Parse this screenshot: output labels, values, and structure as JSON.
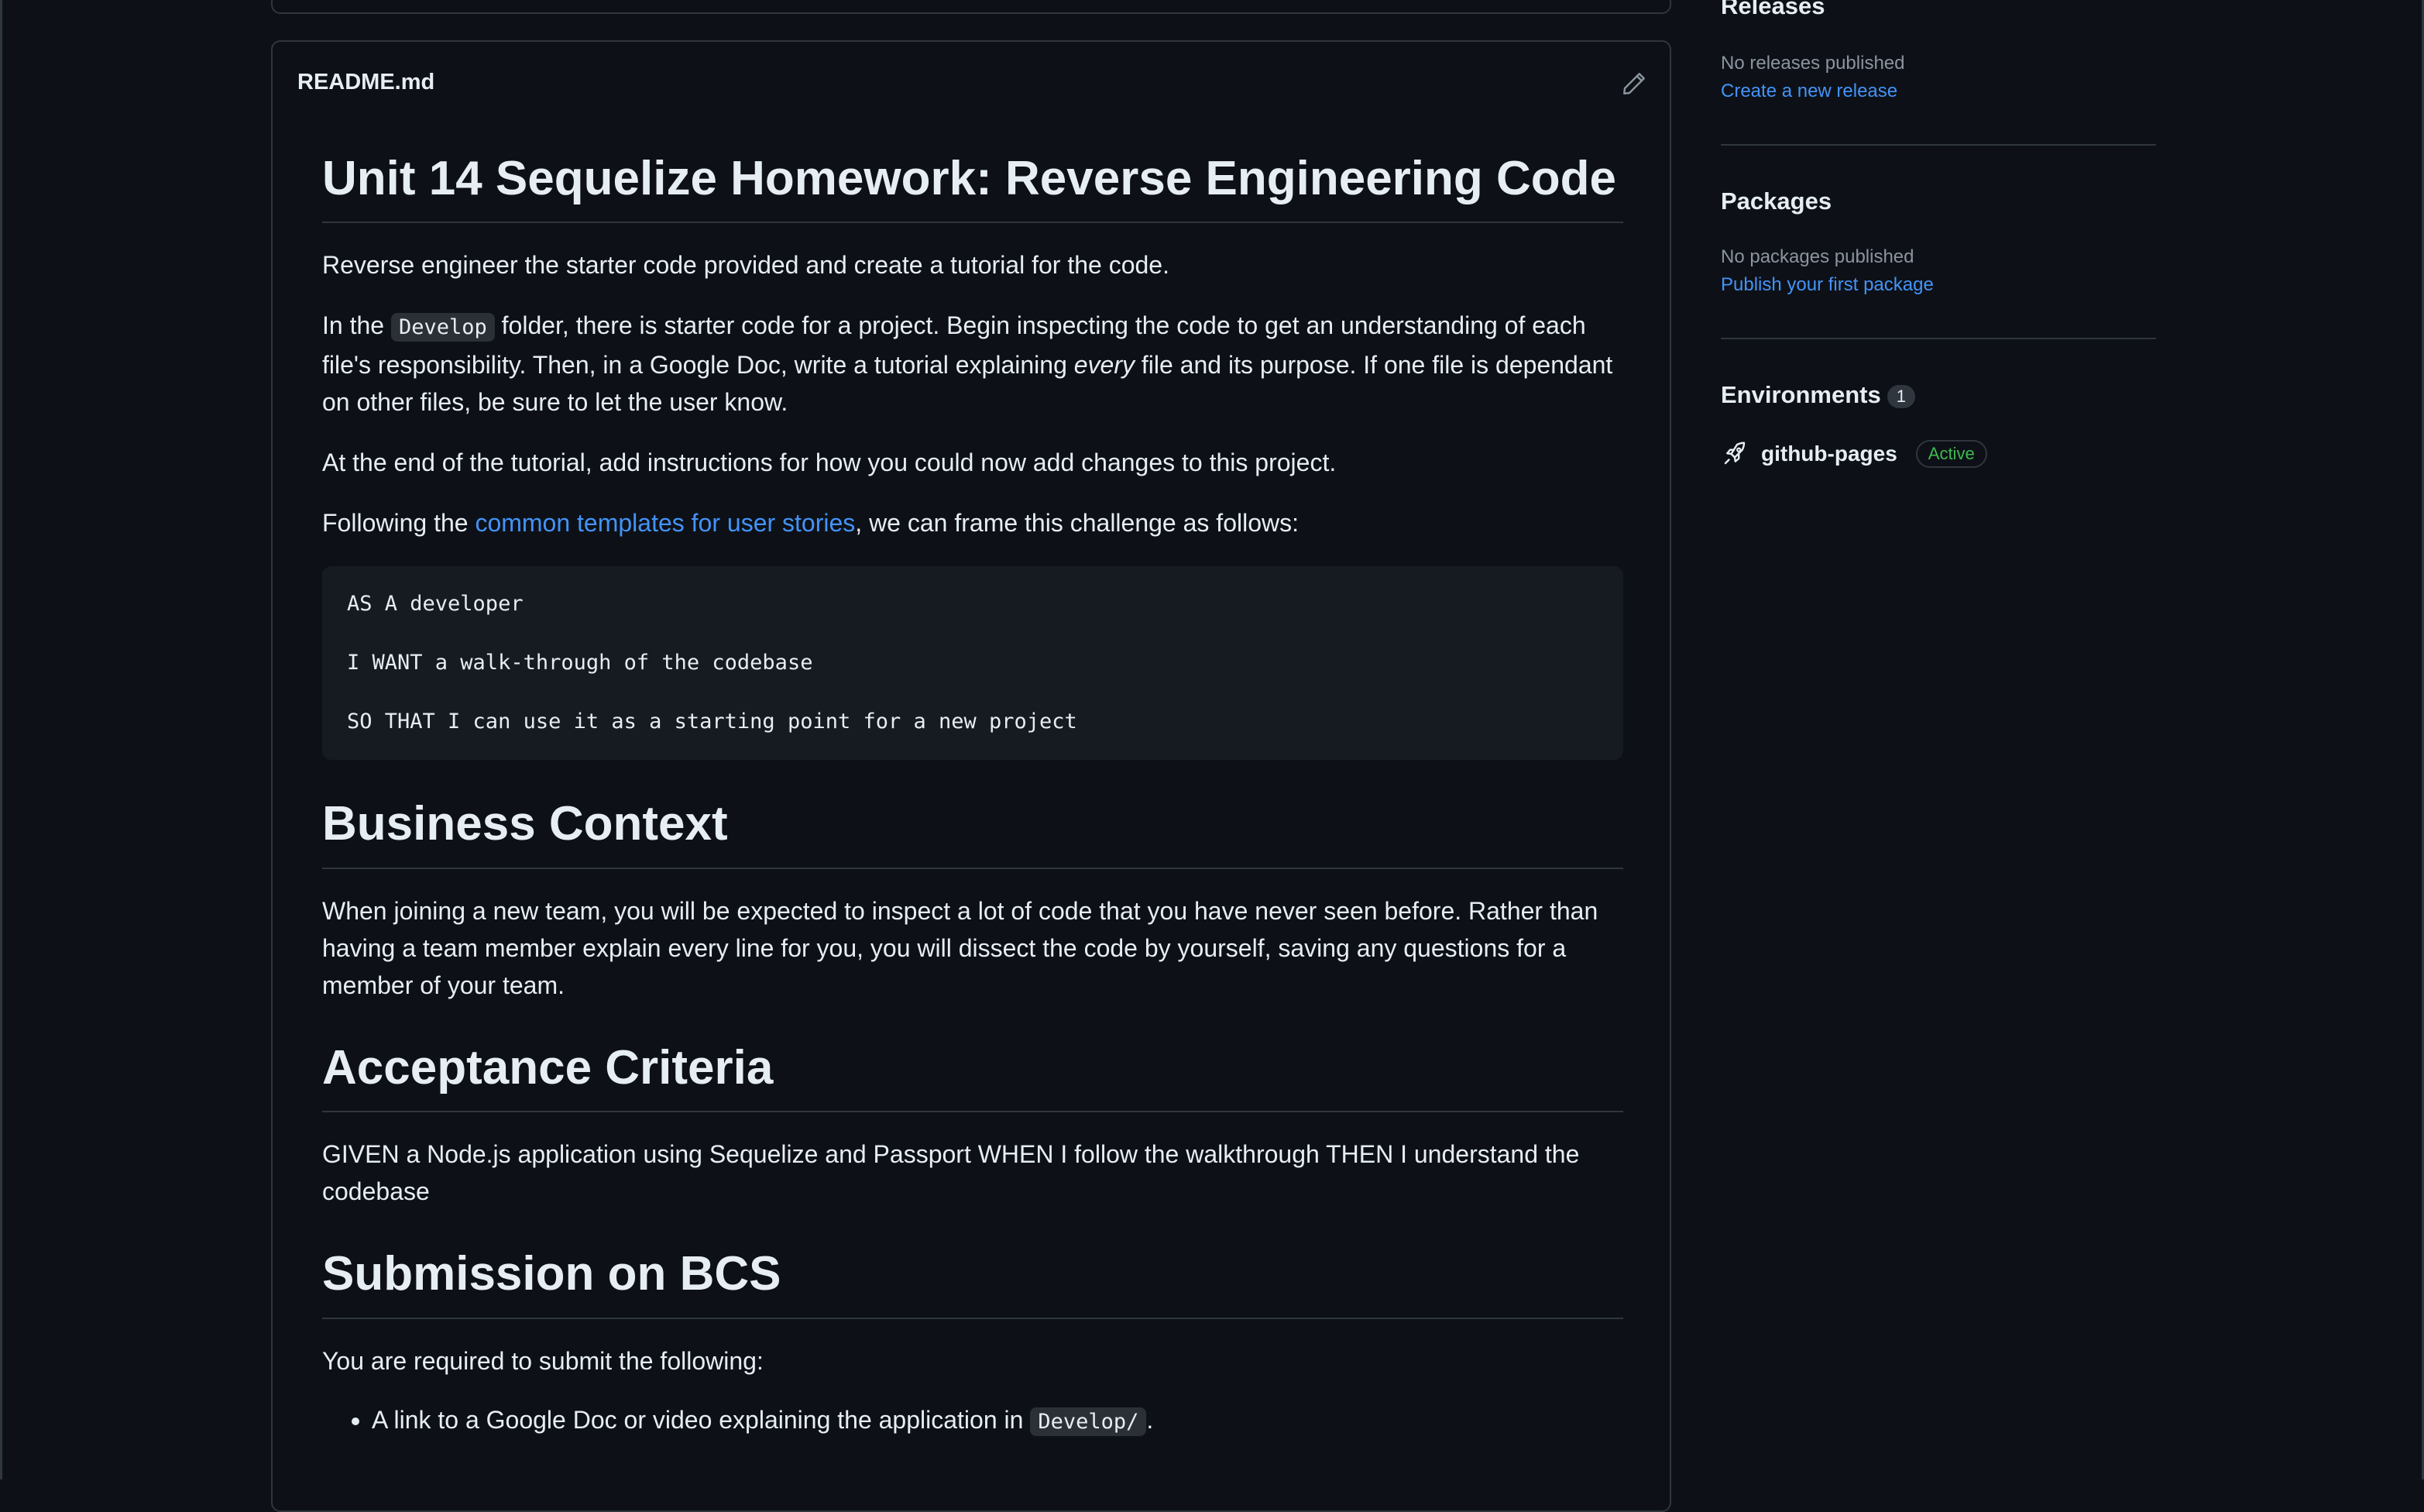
{
  "readme": {
    "filename": "README.md",
    "title": "Unit 14 Sequelize Homework: Reverse Engineering Code",
    "intro": "Reverse engineer the starter code provided and create a tutorial for the code.",
    "p2_prefix": "In the",
    "p2_code": "Develop",
    "p2_mid": "folder, there is starter code for a project. Begin inspecting the code to get an understanding of each file's responsibility. Then, in a Google Doc, write a tutorial explaining",
    "p2_em": "every",
    "p2_suffix": "file and its purpose. If one file is dependant on other files, be sure to let the user know.",
    "p3": "At the end of the tutorial, add instructions for how you could now add changes to this project.",
    "p4_prefix": "Following the",
    "p4_link": "common templates for user stories",
    "p4_suffix": ", we can frame this challenge as follows:",
    "code_block": "AS A developer\n\nI WANT a walk-through of the codebase\n\nSO THAT I can use it as a starting point for a new project",
    "h_business": "Business Context",
    "business_text": "When joining a new team, you will be expected to inspect a lot of code that you have never seen before. Rather than having a team member explain every line for you, you will dissect the code by yourself, saving any questions for a member of your team.",
    "h_acceptance": "Acceptance Criteria",
    "acceptance_text": "GIVEN a Node.js application using Sequelize and Passport WHEN I follow the walkthrough THEN I understand the codebase",
    "h_submission": "Submission on BCS",
    "submission_intro": "You are required to submit the following:",
    "submission_item_prefix": "A link to a Google Doc or video explaining the application in",
    "submission_item_code": "Develop/",
    "submission_item_suffix": "."
  },
  "sidebar": {
    "releases": {
      "title": "Releases",
      "empty": "No releases published",
      "link": "Create a new release"
    },
    "packages": {
      "title": "Packages",
      "empty": "No packages published",
      "link": "Publish your first package"
    },
    "environments": {
      "title": "Environments",
      "count": "1",
      "env_name": "github-pages",
      "env_status": "Active"
    }
  },
  "icons": {
    "edit": "pencil-icon",
    "environment": "rocket-icon"
  },
  "colors": {
    "background": "#0d1117",
    "border": "#30363d",
    "link": "#4493f8",
    "active_badge": "#3fb950"
  }
}
